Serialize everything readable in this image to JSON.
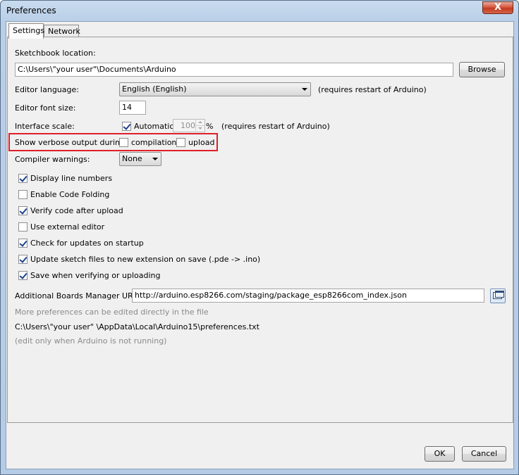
{
  "window": {
    "title": "Preferences",
    "close_glyph": "X"
  },
  "tabs": [
    {
      "label": "Settings",
      "active": true
    },
    {
      "label": "Network",
      "active": false
    }
  ],
  "sketchbook": {
    "label": "Sketchbook location:",
    "value": "C:\\Users\\\"your user\"\\Documents\\Arduino",
    "browse_label": "Browse"
  },
  "editor_language": {
    "label": "Editor language:",
    "value": "English (English)",
    "note": "(requires restart of Arduino)"
  },
  "editor_font_size": {
    "label": "Editor font size:",
    "value": "14"
  },
  "interface_scale": {
    "label": "Interface scale:",
    "automatic_label": "Automatic",
    "automatic_checked": true,
    "value": "100",
    "unit": "%",
    "note": "(requires restart of Arduino)"
  },
  "verbose": {
    "label": "Show verbose output during:",
    "compilation_label": "compilation",
    "compilation_checked": false,
    "upload_label": "upload",
    "upload_checked": false,
    "highlight_color": "#e0202a"
  },
  "compiler_warnings": {
    "label": "Compiler warnings:",
    "value": "None"
  },
  "options": [
    {
      "label": "Display line numbers",
      "checked": true
    },
    {
      "label": "Enable Code Folding",
      "checked": false
    },
    {
      "label": "Verify code after upload",
      "checked": true
    },
    {
      "label": "Use external editor",
      "checked": false
    },
    {
      "label": "Check for updates on startup",
      "checked": true
    },
    {
      "label": "Update sketch files to new extension on save (.pde -> .ino)",
      "checked": true
    },
    {
      "label": "Save when verifying or uploading",
      "checked": true
    }
  ],
  "boards_manager": {
    "label": "Additional Boards Manager URLs:",
    "value": "http://arduino.esp8266.com/staging/package_esp8266com_index.json",
    "icon": "window-edit-icon"
  },
  "info": {
    "more_prefs": "More preferences can be edited directly in the file",
    "path": "C:\\Users\\\"your user\" \\AppData\\Local\\Arduino15\\preferences.txt",
    "edit_note": "(edit only when Arduino is not running)"
  },
  "buttons": {
    "ok": "OK",
    "cancel": "Cancel"
  }
}
